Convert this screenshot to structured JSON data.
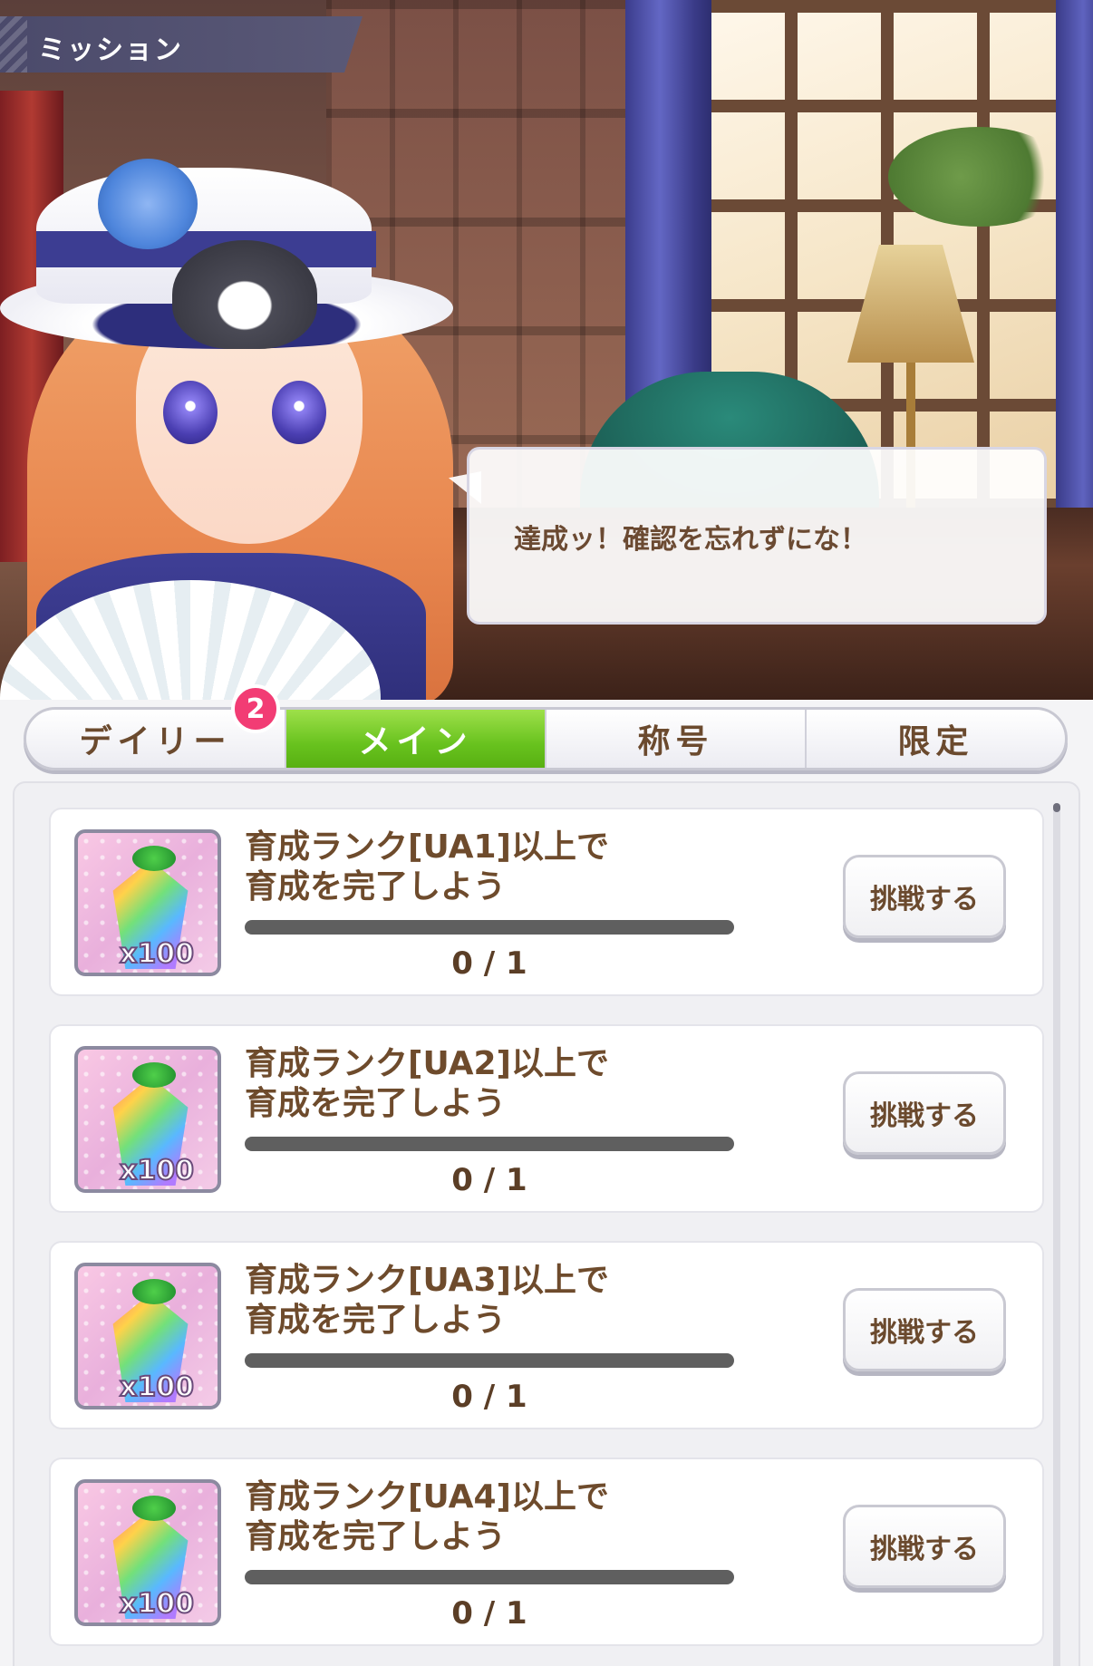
{
  "header": {
    "title": "ミッション"
  },
  "dialogue": {
    "text": "達成ッ！確認を忘れずにな！"
  },
  "tabs": [
    {
      "label": "デイリー",
      "badge": "2",
      "active": false
    },
    {
      "label": "メイン",
      "active": true
    },
    {
      "label": "称号",
      "active": false
    },
    {
      "label": "限定",
      "active": false
    }
  ],
  "missions": [
    {
      "title_line1": "育成ランク[UA1]以上で",
      "title_line2": "育成を完了しよう",
      "progress": "0 / 1",
      "progress_fraction": 0,
      "reward_qty": "x100",
      "button": "挑戦する"
    },
    {
      "title_line1": "育成ランク[UA2]以上で",
      "title_line2": "育成を完了しよう",
      "progress": "0 / 1",
      "progress_fraction": 0,
      "reward_qty": "x100",
      "button": "挑戦する"
    },
    {
      "title_line1": "育成ランク[UA3]以上で",
      "title_line2": "育成を完了しよう",
      "progress": "0 / 1",
      "progress_fraction": 0,
      "reward_qty": "x100",
      "button": "挑戦する"
    },
    {
      "title_line1": "育成ランク[UA4]以上で",
      "title_line2": "育成を完了しよう",
      "progress": "0 / 1",
      "progress_fraction": 0,
      "reward_qty": "x100",
      "button": "挑戦する"
    }
  ],
  "colors": {
    "active_tab": "#68c21e",
    "badge": "#f23c74",
    "text_brown": "#6e4b2c"
  },
  "icons": {
    "reward": "rainbow-crystal-icon"
  }
}
